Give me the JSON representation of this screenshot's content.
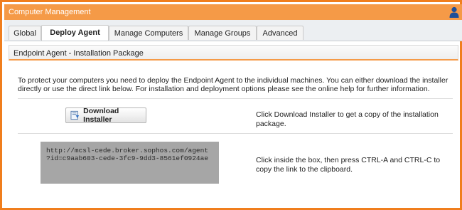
{
  "window": {
    "title": "Computer Management",
    "user_icon": "user-icon"
  },
  "tabs": [
    {
      "label": "Global",
      "active": false
    },
    {
      "label": "Deploy Agent",
      "active": true
    },
    {
      "label": "Manage Computers",
      "active": false
    },
    {
      "label": "Manage Groups",
      "active": false
    },
    {
      "label": "Advanced",
      "active": false
    }
  ],
  "section": {
    "title": "Endpoint Agent - Installation Package"
  },
  "intro_text": "To protect your computers you need to deploy the Endpoint Agent to the individual machines. You can either download the installer directly or use the direct link below. For installation and deployment options please see the online help for further information.",
  "download": {
    "button_label": "Download Installer",
    "icon": "download-installer-icon",
    "description": "Click Download Installer to get a copy of the installation package."
  },
  "link": {
    "line1": "http://mcsl-cede.broker.sophos.com/agent",
    "line2": "?id=c9aab603-cede-3fc9-9dd3-8561ef0924ae",
    "description": "Click inside the box, then press CTRL-A and CTRL-C to copy the link to the clipboard."
  },
  "colors": {
    "accent": "#f07e1d",
    "titlebar": "#f59a47",
    "link_box": "#a6a6a6"
  }
}
